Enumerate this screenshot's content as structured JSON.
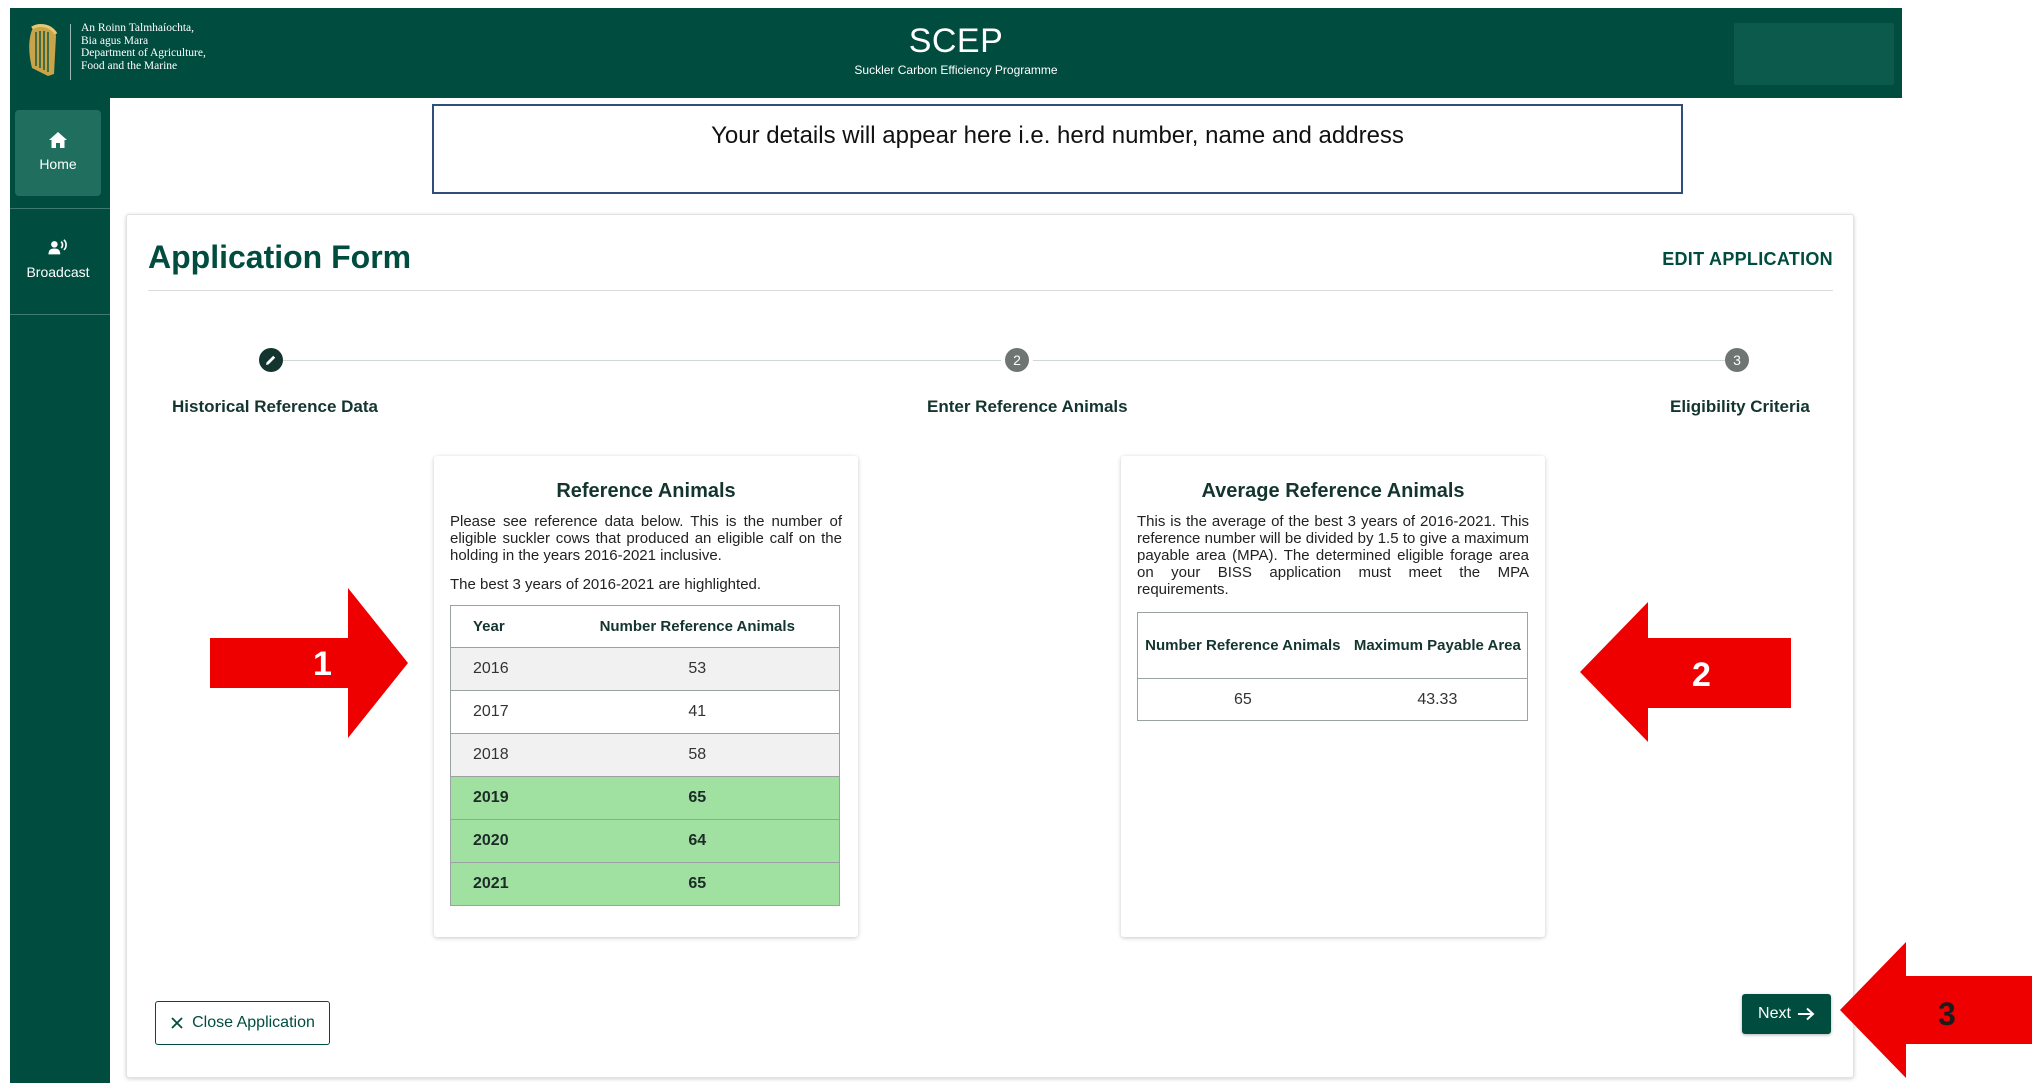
{
  "header": {
    "logo_lines": [
      "An Roinn Talmhaíochta,",
      "Bia agus Mara",
      "Department of Agriculture,",
      "Food and the Marine"
    ],
    "title": "SCEP",
    "subtitle": "Suckler Carbon Efficiency Programme"
  },
  "sidebar": {
    "items": [
      {
        "label": "Home",
        "icon": "home-icon",
        "active": true
      },
      {
        "label": "Broadcast",
        "icon": "broadcast-icon",
        "active": false
      }
    ]
  },
  "details_banner": "Your details will appear here i.e. herd number, name and address",
  "card": {
    "title": "Application Form",
    "edit_label": "EDIT APPLICATION"
  },
  "stepper": {
    "steps": [
      {
        "number": "1",
        "label": "Historical Reference Data",
        "status": "done",
        "icon": "pencil-icon"
      },
      {
        "number": "2",
        "label": "Enter Reference Animals",
        "status": "pending"
      },
      {
        "number": "3",
        "label": "Eligibility Criteria",
        "status": "pending"
      }
    ]
  },
  "reference_panel": {
    "title": "Reference Animals",
    "description": "Please see reference data below. This is the number of eligible suckler cows that produced an eligible calf on the holding in the years 2016-2021 inclusive.",
    "note": "The best 3 years of 2016-2021 are highlighted.",
    "columns": [
      "Year",
      "Number Reference Animals"
    ],
    "rows": [
      {
        "year": "2016",
        "value": "53",
        "highlighted": false
      },
      {
        "year": "2017",
        "value": "41",
        "highlighted": false
      },
      {
        "year": "2018",
        "value": "58",
        "highlighted": false
      },
      {
        "year": "2019",
        "value": "65",
        "highlighted": true
      },
      {
        "year": "2020",
        "value": "64",
        "highlighted": true
      },
      {
        "year": "2021",
        "value": "65",
        "highlighted": true
      }
    ]
  },
  "average_panel": {
    "title": "Average Reference Animals",
    "description": "This is the average of the best 3 years of 2016-2021. This reference number will be divided by 1.5 to give a maximum payable area (MPA). The determined eligible forage area on your BISS application must meet the MPA requirements.",
    "columns": [
      "Number Reference Animals",
      "Maximum Payable Area"
    ],
    "row": {
      "reference_animals": "65",
      "max_payable_area": "43.33"
    }
  },
  "actions": {
    "close_label": "Close Application",
    "next_label": "Next"
  },
  "callouts": [
    "1",
    "2",
    "3"
  ],
  "colors": {
    "brand": "#004d40",
    "highlight": "#a0e0a0",
    "callout": "#ee0000"
  }
}
